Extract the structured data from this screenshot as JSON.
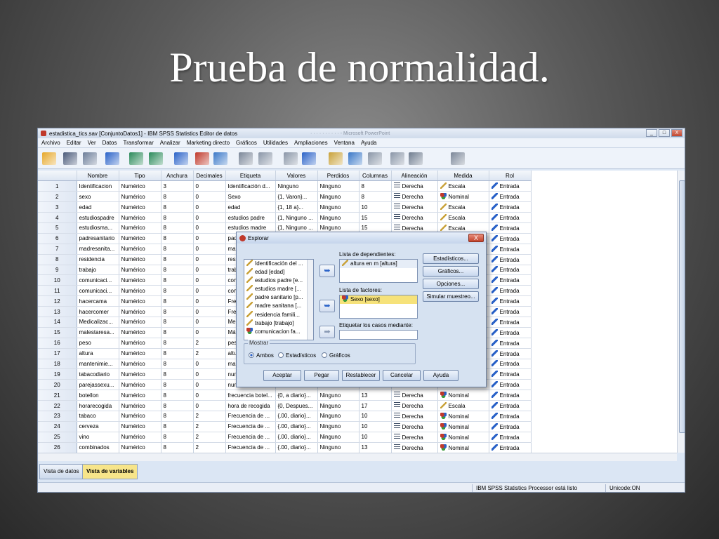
{
  "slide": {
    "title": "Prueba de normalidad."
  },
  "window": {
    "title": "estadistica_tics.sav [ConjuntoDatos1] - IBM SPSS Statistics Editor de datos",
    "ghost_title": "· · · · · · · · · · - Microsoft PowerPoint",
    "buttons": [
      "_",
      "□",
      "X"
    ]
  },
  "menu": [
    "Archivo",
    "Editar",
    "Ver",
    "Datos",
    "Transformar",
    "Analizar",
    "Marketing directo",
    "Gráficos",
    "Utilidades",
    "Ampliaciones",
    "Ventana",
    "Ayuda"
  ],
  "toolbar_icons": [
    "open-icon",
    "save-icon",
    "print-icon",
    "dialog-recall-icon",
    "undo-icon",
    "redo-icon",
    "goto-case-icon",
    "goto-variable-icon",
    "variables-icon",
    "find-icon",
    "insert-cases-icon",
    "insert-variable-icon",
    "split-file-icon",
    "weight-cases-icon",
    "select-cases-icon",
    "value-labels-icon",
    "use-sets-icon",
    "show-all-icon",
    "spell-icon"
  ],
  "grid": {
    "headers": [
      "",
      "Nombre",
      "Tipo",
      "Anchura",
      "Decimales",
      "Etiqueta",
      "Valores",
      "Perdidos",
      "Columnas",
      "Alineación",
      "Medida",
      "Rol"
    ],
    "rows": [
      [
        "1",
        "Identificacion",
        "Numérico",
        "3",
        "0",
        "Identificación d...",
        "Ninguno",
        "Ninguno",
        "8",
        "Derecha",
        "Escala",
        "Entrada"
      ],
      [
        "2",
        "sexo",
        "Numérico",
        "8",
        "0",
        "Sexo",
        "{1, Varon}...",
        "Ninguno",
        "8",
        "Derecha",
        "Nominal",
        "Entrada"
      ],
      [
        "3",
        "edad",
        "Numérico",
        "8",
        "0",
        "edad",
        "{1, 18 a}...",
        "Ninguno",
        "10",
        "Derecha",
        "Escala",
        "Entrada"
      ],
      [
        "4",
        "estudiospadre",
        "Numérico",
        "8",
        "0",
        "estudios padre",
        "{1, Ninguno ...",
        "Ninguno",
        "15",
        "Derecha",
        "Escala",
        "Entrada"
      ],
      [
        "5",
        "estudiosma...",
        "Numérico",
        "8",
        "0",
        "estudios madre",
        "{1, Ninguno ...",
        "Ninguno",
        "15",
        "Derecha",
        "Escala",
        "Entrada"
      ],
      [
        "6",
        "padresanitario",
        "Numérico",
        "8",
        "0",
        "pad",
        "",
        "",
        "",
        "",
        "",
        "Entrada"
      ],
      [
        "7",
        "madresanita...",
        "Numérico",
        "8",
        "0",
        "mad",
        "",
        "",
        "",
        "",
        "",
        "Entrada"
      ],
      [
        "8",
        "residencia",
        "Numérico",
        "8",
        "0",
        "resi",
        "",
        "",
        "",
        "",
        "",
        "Entrada"
      ],
      [
        "9",
        "trabajo",
        "Numérico",
        "8",
        "0",
        "trab",
        "",
        "",
        "",
        "",
        "",
        "Entrada"
      ],
      [
        "10",
        "comunicaci...",
        "Numérico",
        "8",
        "0",
        "com",
        "",
        "",
        "",
        "",
        "",
        "Entrada"
      ],
      [
        "11",
        "comunicaci...",
        "Numérico",
        "8",
        "0",
        "com",
        "",
        "",
        "",
        "",
        "",
        "Entrada"
      ],
      [
        "12",
        "hacercama",
        "Numérico",
        "8",
        "0",
        "Frec",
        "",
        "",
        "",
        "",
        "",
        "Entrada"
      ],
      [
        "13",
        "hacercomer",
        "Numérico",
        "8",
        "0",
        "Frec",
        "",
        "",
        "",
        "",
        "",
        "Entrada"
      ],
      [
        "14",
        "Medicalizac...",
        "Numérico",
        "8",
        "0",
        "Med",
        "",
        "",
        "",
        "",
        "",
        "Entrada"
      ],
      [
        "15",
        "malestaresa...",
        "Numérico",
        "8",
        "0",
        "Más",
        "",
        "",
        "",
        "",
        "",
        "Entrada"
      ],
      [
        "16",
        "peso",
        "Numérico",
        "8",
        "2",
        "pes",
        "",
        "",
        "",
        "",
        "",
        "Entrada"
      ],
      [
        "17",
        "altura",
        "Numérico",
        "8",
        "2",
        "altu",
        "",
        "",
        "",
        "",
        "",
        "Entrada"
      ],
      [
        "18",
        "mantenimie...",
        "Numérico",
        "8",
        "0",
        "man",
        "",
        "",
        "",
        "",
        "",
        "Entrada"
      ],
      [
        "19",
        "tabacodiario",
        "Numérico",
        "8",
        "0",
        "nun",
        "",
        "",
        "",
        "",
        "",
        "Entrada"
      ],
      [
        "20",
        "parejassexu...",
        "Numérico",
        "8",
        "0",
        "nun",
        "",
        "",
        "",
        "",
        "",
        "Entrada"
      ],
      [
        "21",
        "botellon",
        "Numérico",
        "8",
        "0",
        "frecuencia botel...",
        "{0, a diario}...",
        "Ninguno",
        "13",
        "Derecha",
        "Nominal",
        "Entrada"
      ],
      [
        "22",
        "horarecogida",
        "Numérico",
        "8",
        "0",
        "hora de recogida",
        "{0, Despues...",
        "Ninguno",
        "17",
        "Derecha",
        "Escala",
        "Entrada"
      ],
      [
        "23",
        "tabaco",
        "Numérico",
        "8",
        "2",
        "Frecuencia de ...",
        "{.00, diario}...",
        "Ninguno",
        "10",
        "Derecha",
        "Nominal",
        "Entrada"
      ],
      [
        "24",
        "cerveza",
        "Numérico",
        "8",
        "2",
        "Frecuencia de ...",
        "{.00, diario}...",
        "Ninguno",
        "10",
        "Derecha",
        "Nominal",
        "Entrada"
      ],
      [
        "25",
        "vino",
        "Numérico",
        "8",
        "2",
        "Frecuencia de ...",
        "{.00, diario}...",
        "Ninguno",
        "10",
        "Derecha",
        "Nominal",
        "Entrada"
      ],
      [
        "26",
        "combinados",
        "Numérico",
        "8",
        "2",
        "Frecuencia de ...",
        "{.00, diario}...",
        "Ninguno",
        "13",
        "Derecha",
        "Nominal",
        "Entrada"
      ]
    ]
  },
  "tabs": {
    "data_view": "Vista de datos",
    "variable_view": "Vista de variables"
  },
  "status": {
    "processor": "IBM SPSS Statistics Processor está listo",
    "unicode": "Unicode:ON"
  },
  "dialog": {
    "title": "Explorar",
    "close": "X",
    "source_items": [
      "Identificación del ...",
      "edad [edad]",
      "estudios padre [e...",
      "estudios madre [...",
      "padre sanitario [p...",
      "madre sanitana [...",
      "residencia famili...",
      "trabajo [trabajo]",
      "comunicacion fa..."
    ],
    "dependents_label": "Lista de dependientes:",
    "dependents": [
      "altura en m [altura]"
    ],
    "factors_label": "Lista de factores:",
    "factors": [
      "Sexo [sexo]"
    ],
    "label_cases_label": "Etiquetar los casos mediante:",
    "side_buttons": [
      "Estadísticos...",
      "Gráficos...",
      "Opciones...",
      "Simular muestreo..."
    ],
    "display_legend": "Mostrar",
    "display_options": [
      "Ambos",
      "Estadísticos",
      "Gráficos"
    ],
    "display_selected": "Ambos",
    "bottom_buttons": [
      "Aceptar",
      "Pegar",
      "Restablecer",
      "Cancelar",
      "Ayuda"
    ]
  },
  "colors": {
    "scale_icon": "#c9a23a",
    "nominal_icon": "#c0392b",
    "role_icon": "#2a62c8",
    "selected_item": "#f6e27a",
    "view_tab_active": "#f7e58a"
  }
}
